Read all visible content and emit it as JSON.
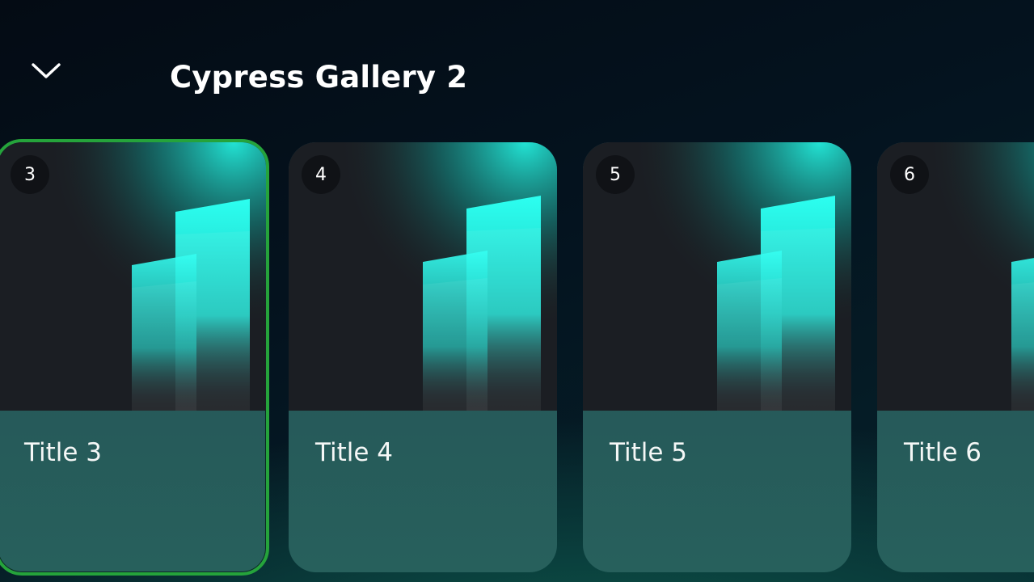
{
  "header": {
    "title": "Cypress Gallery 2",
    "collapse_icon": "chevron-down-icon"
  },
  "colors": {
    "focus_border": "#25a33b",
    "card_footer": "#27605c",
    "thumb_bg": "#1b1e23",
    "accent_glow": "#2af5e6"
  },
  "cards": [
    {
      "number": "3",
      "title": "Title 3",
      "focused": true
    },
    {
      "number": "4",
      "title": "Title 4",
      "focused": false
    },
    {
      "number": "5",
      "title": "Title 5",
      "focused": false
    },
    {
      "number": "6",
      "title": "Title 6",
      "focused": false
    }
  ]
}
